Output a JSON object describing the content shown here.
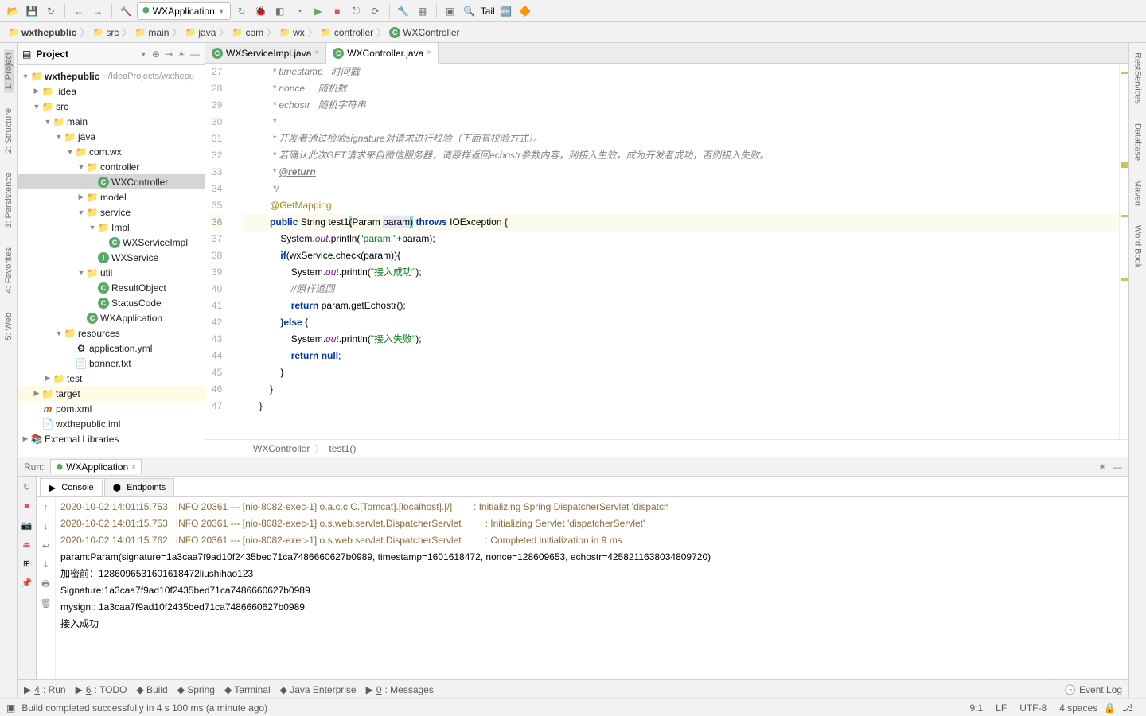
{
  "toolbar": {
    "run_config": "WXApplication",
    "tail": "Tail"
  },
  "breadcrumbs": [
    {
      "icon": "folder",
      "label": "wxthepublic"
    },
    {
      "icon": "folder",
      "label": "src"
    },
    {
      "icon": "folder",
      "label": "main"
    },
    {
      "icon": "folder",
      "label": "java"
    },
    {
      "icon": "folder",
      "label": "com"
    },
    {
      "icon": "folder",
      "label": "wx"
    },
    {
      "icon": "folder",
      "label": "controller"
    },
    {
      "icon": "class",
      "label": "WXController"
    }
  ],
  "left_tabs": [
    "Project",
    "Structure",
    "Persistence",
    "Favorites",
    "Web"
  ],
  "right_tabs": [
    "RestServices",
    "Database",
    "Maven",
    "Word Book"
  ],
  "project": {
    "header": "Project",
    "root": {
      "label": "wxthepublic",
      "suffix": "~/IdeaProjects/wxthepu"
    },
    "nodes": [
      {
        "indent": 1,
        "arrow": "▶",
        "icon": "folder",
        "label": ".idea"
      },
      {
        "indent": 1,
        "arrow": "▼",
        "icon": "folder",
        "label": "src"
      },
      {
        "indent": 2,
        "arrow": "▼",
        "icon": "folder",
        "label": "main"
      },
      {
        "indent": 3,
        "arrow": "▼",
        "icon": "folder-src",
        "label": "java"
      },
      {
        "indent": 4,
        "arrow": "▼",
        "icon": "folder",
        "label": "com.wx"
      },
      {
        "indent": 5,
        "arrow": "▼",
        "icon": "folder",
        "label": "controller"
      },
      {
        "indent": 6,
        "arrow": "",
        "icon": "class",
        "label": "WXController",
        "sel": true
      },
      {
        "indent": 5,
        "arrow": "▶",
        "icon": "folder",
        "label": "model"
      },
      {
        "indent": 5,
        "arrow": "▼",
        "icon": "folder",
        "label": "service"
      },
      {
        "indent": 6,
        "arrow": "▼",
        "icon": "folder",
        "label": "Impl"
      },
      {
        "indent": 7,
        "arrow": "",
        "icon": "class",
        "label": "WXServiceImpl"
      },
      {
        "indent": 6,
        "arrow": "",
        "icon": "interface",
        "label": "WXService"
      },
      {
        "indent": 5,
        "arrow": "▼",
        "icon": "folder",
        "label": "util"
      },
      {
        "indent": 6,
        "arrow": "",
        "icon": "class",
        "label": "ResultObject"
      },
      {
        "indent": 6,
        "arrow": "",
        "icon": "class",
        "label": "StatusCode"
      },
      {
        "indent": 5,
        "arrow": "",
        "icon": "class",
        "label": "WXApplication"
      },
      {
        "indent": 3,
        "arrow": "▼",
        "icon": "folder-res",
        "label": "resources"
      },
      {
        "indent": 4,
        "arrow": "",
        "icon": "yml",
        "label": "application.yml"
      },
      {
        "indent": 4,
        "arrow": "",
        "icon": "txt",
        "label": "banner.txt"
      },
      {
        "indent": 2,
        "arrow": "▶",
        "icon": "folder",
        "label": "test"
      },
      {
        "indent": 1,
        "arrow": "▶",
        "icon": "folder-tgt",
        "label": "target",
        "tgt": true
      },
      {
        "indent": 1,
        "arrow": "",
        "icon": "maven",
        "label": "pom.xml"
      },
      {
        "indent": 1,
        "arrow": "",
        "icon": "file",
        "label": "wxthepublic.iml"
      },
      {
        "indent": 0,
        "arrow": "▶",
        "icon": "lib",
        "label": "External Libraries"
      }
    ]
  },
  "tabs": [
    {
      "label": "WXServiceImpl.java",
      "active": false
    },
    {
      "label": "WXController.java",
      "active": true
    }
  ],
  "code": {
    "first_line": 27,
    "highlight": 36,
    "lines": [
      " * timestamp   时间戳",
      " * nonce     随机数",
      " * echostr   随机字符串",
      " *",
      " * 开发者通过检验signature对请求进行校验（下面有校验方式）。",
      " * 若确认此次GET请求来自微信服务器，请原样返回echostr参数内容，则接入生效，成为开发者成功，否则接入失败。",
      " * @return",
      " */",
      "@GetMapping",
      "public String test1(Param param) throws IOException {",
      "    System.out.println(\"param:\"+param);",
      "    if(wxService.check(param)){",
      "        System.out.println(\"接入成功\");",
      "        //原样返回",
      "        return param.getEchostr();",
      "    }else {",
      "        System.out.println(\"接入失败\");",
      "        return null;",
      "    }",
      "}",
      "}"
    ]
  },
  "editor_path": [
    "WXController",
    "test1()"
  ],
  "run": {
    "label": "Run:",
    "app": "WXApplication",
    "subtabs": [
      "Console",
      "Endpoints"
    ],
    "logs": [
      {
        "type": "log",
        "text": "2020-10-02 14:01:15.753   INFO 20361 --- [nio-8082-exec-1] o.a.c.c.C.[Tomcat].[localhost].[/]        : Initializing Spring DispatcherServlet 'dispatch"
      },
      {
        "type": "log",
        "text": "2020-10-02 14:01:15.753   INFO 20361 --- [nio-8082-exec-1] o.s.web.servlet.DispatcherServlet         : Initializing Servlet 'dispatcherServlet'"
      },
      {
        "type": "log",
        "text": "2020-10-02 14:01:15.762   INFO 20361 --- [nio-8082-exec-1] o.s.web.servlet.DispatcherServlet         : Completed initialization in 9 ms"
      },
      {
        "type": "plain",
        "text": "param:Param(signature=1a3caa7f9ad10f2435bed71ca7486660627b0989, timestamp=1601618472, nonce=128609653, echostr=4258211638034809720)"
      },
      {
        "type": "plain",
        "text": "加密前：1286096531601618472liushihao123"
      },
      {
        "type": "plain",
        "text": "Signature:1a3caa7f9ad10f2435bed71ca7486660627b0989"
      },
      {
        "type": "plain",
        "text": "mysign:: 1a3caa7f9ad10f2435bed71ca7486660627b0989"
      },
      {
        "type": "plain",
        "text": "接入成功"
      }
    ]
  },
  "bottom": {
    "items": [
      "4: Run",
      "6: TODO",
      "Build",
      "Spring",
      "Terminal",
      "Java Enterprise",
      "0: Messages"
    ],
    "event_log": "Event Log"
  },
  "status": {
    "message": "Build completed successfully in 4 s 100 ms (a minute ago)",
    "pos": "9:1",
    "le": "LF",
    "enc": "UTF-8",
    "indent": "4 spaces"
  }
}
